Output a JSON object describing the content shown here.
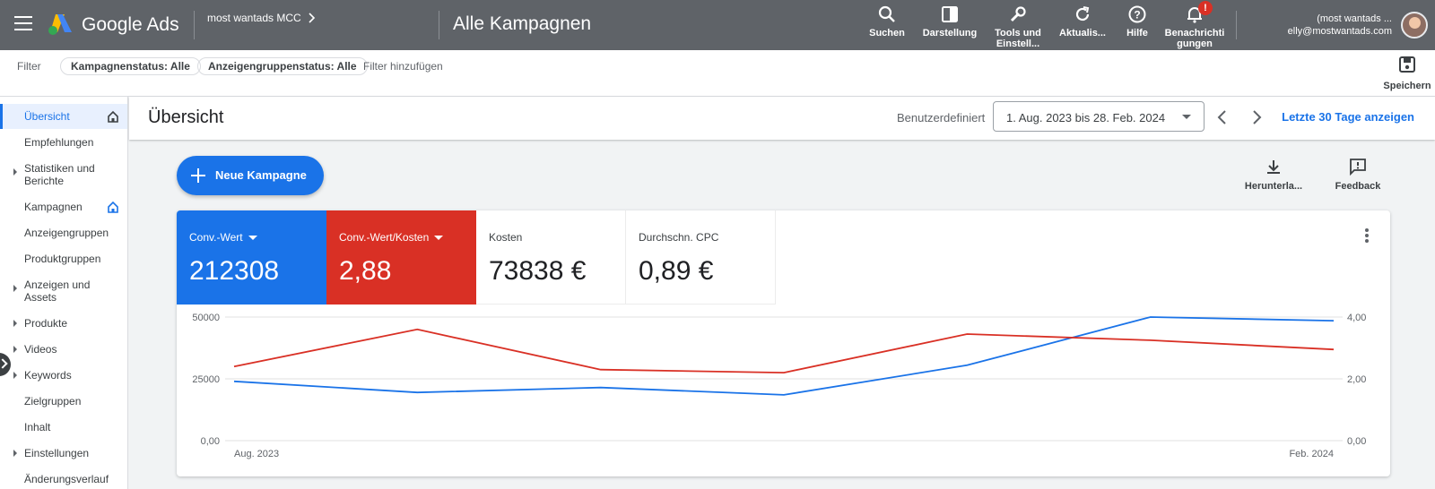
{
  "topbar": {
    "brand": "Google Ads",
    "account": "most wantads MCC",
    "page_heading": "Alle Kampagnen",
    "tools": [
      {
        "label": "Suchen"
      },
      {
        "label": "Darstellung"
      },
      {
        "label": "Tools und\nEinstell..."
      },
      {
        "label": "Aktualis..."
      },
      {
        "label": "Hilfe"
      },
      {
        "label": "Benachrichti\ngungen",
        "badge": "!"
      }
    ],
    "user_name": "(most wantads ...",
    "user_email": "elly@mostwantads.com"
  },
  "filterbar": {
    "label": "Filter",
    "chips": [
      "Kampagnenstatus: Alle",
      "Anzeigengruppenstatus: Alle"
    ],
    "add_filter": "Filter hinzufügen",
    "save_label": "Speichern"
  },
  "sidebar": {
    "items": [
      {
        "label": "Übersicht",
        "active": true,
        "home": true,
        "caret": false
      },
      {
        "label": "Empfehlungen",
        "caret": false
      },
      {
        "label": "Statistiken und Berichte",
        "caret": true
      },
      {
        "label": "Kampagnen",
        "home": true,
        "caret": false
      },
      {
        "label": "Anzeigengruppen",
        "caret": false
      },
      {
        "label": "Produktgruppen",
        "caret": false
      },
      {
        "label": "Anzeigen und Assets",
        "caret": true
      },
      {
        "label": "Produkte",
        "caret": true
      },
      {
        "label": "Videos",
        "caret": true
      },
      {
        "label": "Keywords",
        "caret": true
      },
      {
        "label": "Zielgruppen",
        "caret": false
      },
      {
        "label": "Inhalt",
        "caret": false
      },
      {
        "label": "Einstellungen",
        "caret": true
      },
      {
        "label": "Änderungsverlauf",
        "caret": false
      }
    ]
  },
  "main": {
    "title": "Übersicht",
    "range_type": "Benutzerdefiniert",
    "date_range": "1. Aug. 2023 bis 28. Feb. 2024",
    "last30": "Letzte 30 Tage anzeigen",
    "new_campaign": "Neue Kampagne",
    "download": "Herunterla...",
    "feedback": "Feedback"
  },
  "metrics": [
    {
      "name": "Conv.-Wert",
      "value": "212308",
      "style": "blue",
      "dropdown": true
    },
    {
      "name": "Conv.-Wert/Kosten",
      "value": "2,88",
      "style": "red",
      "dropdown": true
    },
    {
      "name": "Kosten",
      "value": "73838 €",
      "style": "plain"
    },
    {
      "name": "Durchschn. CPC",
      "value": "0,89 €",
      "style": "plain"
    }
  ],
  "chart_data": {
    "type": "line",
    "x": [
      "2023-08",
      "2023-09",
      "2023-10",
      "2023-11",
      "2023-12",
      "2024-01",
      "2024-02"
    ],
    "x_tick_labels": [
      "Aug. 2023",
      "Feb. 2024"
    ],
    "left_axis": {
      "ticks": [
        "50000",
        "25000",
        "0,00"
      ],
      "ylim": [
        0,
        50000
      ]
    },
    "right_axis": {
      "ticks": [
        "4,00",
        "2,00",
        "0,00"
      ],
      "ylim": [
        0,
        4
      ]
    },
    "grid": true,
    "series": [
      {
        "metric": "Conv.-Wert",
        "axis": "left",
        "color": "#1a73e8",
        "values": [
          24000,
          19500,
          21500,
          18500,
          30500,
          50000,
          48500
        ]
      },
      {
        "metric": "Conv.-Wert/Kosten",
        "axis": "right",
        "color": "#d93025",
        "values": [
          2.4,
          3.6,
          2.3,
          2.2,
          3.45,
          3.25,
          2.95
        ]
      }
    ]
  }
}
